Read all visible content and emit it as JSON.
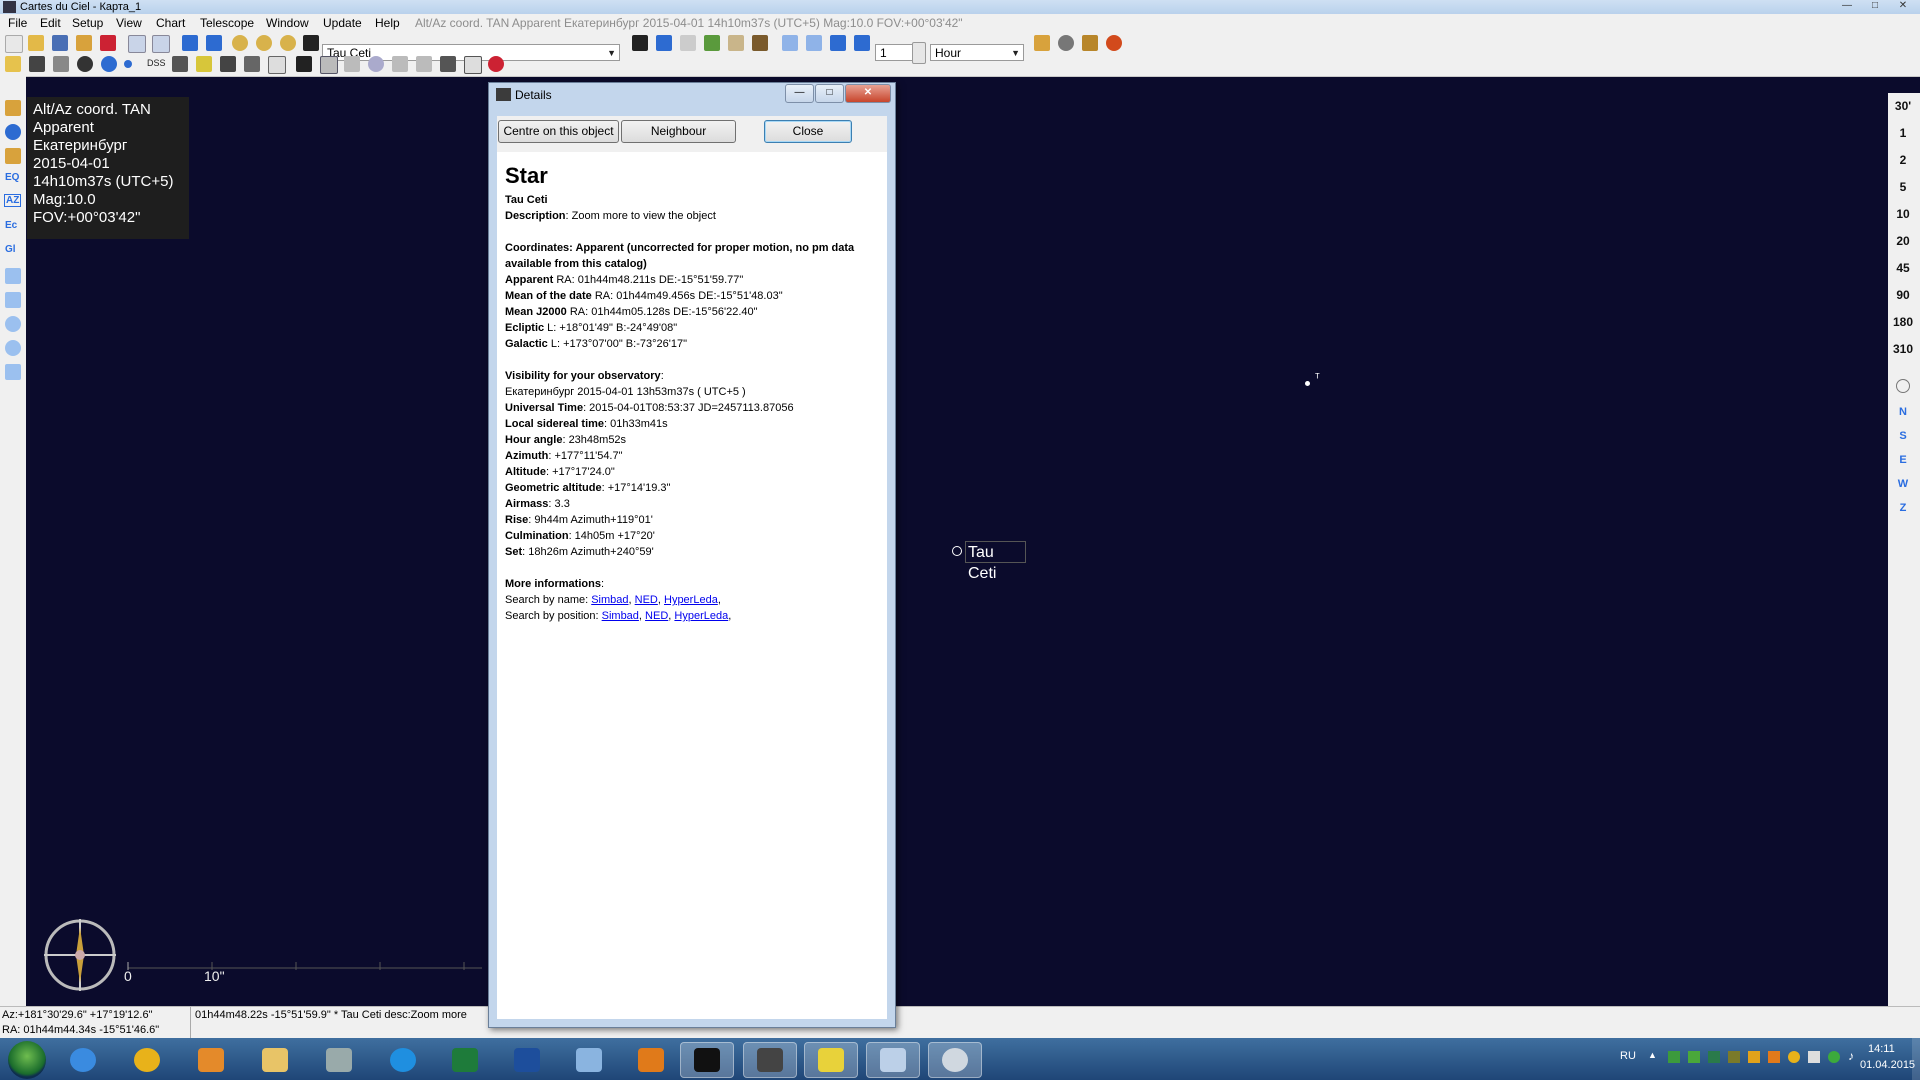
{
  "window": {
    "title": "Cartes du Ciel - Карта_1"
  },
  "menu": {
    "items": [
      "File",
      "Edit",
      "Setup",
      "View",
      "Chart",
      "Telescope",
      "Window",
      "Update",
      "Help"
    ],
    "status": "Alt/Az coord. TAN Apparent Екатеринбург 2015-04-01 14h10m37s (UTC+5) Mag:10.0 FOV:+00°03'42\""
  },
  "toolbar": {
    "search_value": "Tau Ceti",
    "step_value": "1",
    "unit_value": "Hour",
    "dss_label": "DSS"
  },
  "infobox": {
    "lines": [
      "Alt/Az coord. TAN",
      "Apparent",
      "Екатеринбург",
      "2015-04-01",
      "14h10m37s (UTC+5)",
      "Mag:10.0",
      "FOV:+00°03'42\""
    ]
  },
  "right_scale": {
    "fov_labels": [
      "30'",
      "1",
      "2",
      "5",
      "10",
      "20",
      "45",
      "90",
      "180",
      "310"
    ],
    "direction_labels": [
      "N",
      "S",
      "E",
      "W",
      "Z"
    ]
  },
  "sky": {
    "target_label": "Tau Ceti",
    "scale_start": "0",
    "scale_end": "10\""
  },
  "statusbar": {
    "left_line1": "Az:+181°30'29.6\" +17°19'12.6\"",
    "left_line2": "RA: 01h44m44.34s -15°51'46.6\"",
    "main": "01h44m48.22s -15°51'59.9\" * Tau Ceti desc:Zoom more"
  },
  "dialog": {
    "title": "Details",
    "buttons": {
      "centre": "Centre on this object",
      "neighbour": "Neighbour",
      "close": "Close"
    },
    "heading": "Star",
    "name": "Tau Ceti",
    "description_label": "Description",
    "description": ": Zoom more to view the object",
    "coord_header": "Coordinates: Apparent (uncorrected for proper motion, no pm data available from this catalog)",
    "coords": [
      {
        "label": "Apparent",
        "value": " RA: 01h44m48.211s DE:-15°51'59.77\""
      },
      {
        "label": "Mean of the date",
        "value": " RA: 01h44m49.456s DE:-15°51'48.03\""
      },
      {
        "label": "Mean J2000",
        "value": " RA: 01h44m05.128s DE:-15°56'22.40\""
      },
      {
        "label": "Ecliptic",
        "value": "  L: +18°01'49\" B:-24°49'08\""
      },
      {
        "label": "Galactic",
        "value": "  L: +173°07'00\" B:-73°26'17\""
      }
    ],
    "visibility_header": "Visibility for your observatory",
    "visibility_location": "Екатеринбург 2015-04-01 13h53m37s ( UTC+5 )",
    "visibility": [
      {
        "label": "Universal Time",
        "value": ": 2015-04-01T08:53:37 JD=2457113.87056"
      },
      {
        "label": "Local sidereal time",
        "value": ": 01h33m41s"
      },
      {
        "label": "Hour angle",
        "value": ": 23h48m52s"
      },
      {
        "label": "Azimuth",
        "value": ": +177°11'54.7\""
      },
      {
        "label": "Altitude",
        "value": ": +17°17'24.0\""
      },
      {
        "label": "Geometric altitude",
        "value": ": +17°14'19.3\""
      },
      {
        "label": "Airmass",
        "value": ": 3.3"
      },
      {
        "label": "Rise",
        "value": ": 9h44m Azimuth+119°01'"
      },
      {
        "label": "Culmination",
        "value": ": 14h05m +17°20'"
      },
      {
        "label": "Set",
        "value": ": 18h26m Azimuth+240°59'"
      }
    ],
    "more_header": "More informations",
    "search_name_label": "Search by name: ",
    "search_position_label": "Search by position: ",
    "links": [
      "Simbad",
      "NED",
      "HyperLeda"
    ]
  },
  "tray": {
    "lang": "RU",
    "time": "14:11",
    "date": "01.04.2015"
  },
  "colors": {
    "sky": "#0b0b2c",
    "accent": "#2a6de0"
  }
}
